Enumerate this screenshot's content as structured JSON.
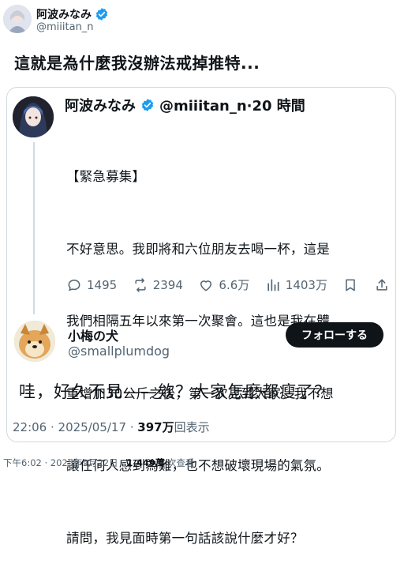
{
  "outer_tweet": {
    "name": "阿波みなみ",
    "handle": "@miiitan_n",
    "text": "這就是為什麼我沒辦法戒掉推特..."
  },
  "quoted_tweet": {
    "name": "阿波みなみ",
    "handle_time": "@miiitan_n·20 時間",
    "lines": [
      "【緊急募集】",
      "不好意思。我即將和六位朋友去喝一杯，這是",
      "我們相隔五年以來第一次聚會。這也是我在體",
      "重增加30公斤之後，第一次見到大家。我不想",
      "讓任何人感到為難，也不想破壞現場的氣氛。",
      "請問，我見面時第一句話該說什麼才好？"
    ],
    "actions": {
      "replies": "1495",
      "retweets": "2394",
      "likes": "6.6万",
      "views": "1403万"
    }
  },
  "reply": {
    "name": "小梅の犬",
    "handle": "@smallplumdog",
    "follow_label": "フォローする",
    "text": "哇，好久不見——欸？大家怎麼都瘦了？",
    "time": "22:06 · 2025/05/17 · ",
    "views_count": "397万",
    "views_suffix": "回表示"
  },
  "footer": {
    "time": "下午6:02 · 2025年9月22日 · ",
    "views_count": "1,449萬",
    "views_suffix": " 次查看"
  },
  "colors": {
    "verified": "#1d9bf0",
    "text": "#0f1419",
    "secondary": "#536471",
    "border": "#cfd9de"
  },
  "icons": [
    "verified-icon",
    "reply-icon",
    "retweet-icon",
    "like-icon",
    "views-icon",
    "bookmark-icon",
    "share-icon"
  ]
}
